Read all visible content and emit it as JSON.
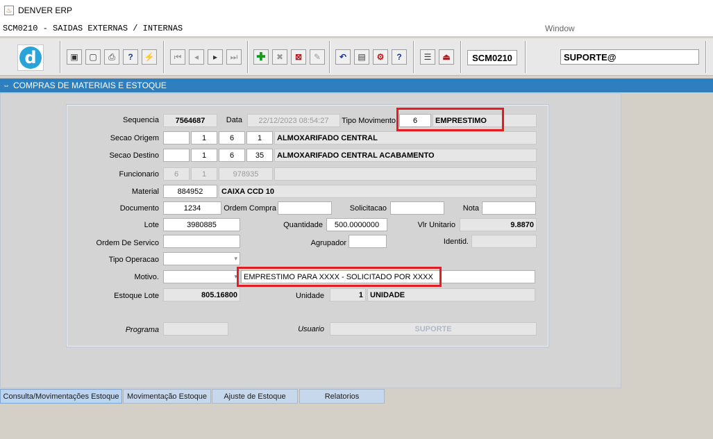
{
  "window": {
    "title": "DENVER ERP",
    "form_name": "SCM0210 - SAIDAS EXTERNAS / INTERNAS",
    "window_menu": "Window"
  },
  "toolbar": {
    "form_code": "SCM0210",
    "user": "SUPORTE@",
    "logo_letter": "d"
  },
  "header": {
    "title": "COMPRAS DE MATERIAIS E ESTOQUE"
  },
  "labels": {
    "sequencia": "Sequencia",
    "data": "Data",
    "tipo_movimento": "Tipo Movimento",
    "secao_origem": "Secao Origem",
    "secao_destino": "Secao Destino",
    "funcionario": "Funcionario",
    "material": "Material",
    "documento": "Documento",
    "ordem_compra": "Ordem Compra",
    "solicitacao": "Solicitacao",
    "nota": "Nota",
    "lote": "Lote",
    "quantidade": "Quantidade",
    "vlr_unitario": "Vlr Unitario",
    "ordem_servico": "Ordem De Servico",
    "agrupador": "Agrupador",
    "identid": "Identid.",
    "tipo_operacao": "Tipo Operacao",
    "motivo": "Motivo.",
    "estoque_lote": "Estoque Lote",
    "unidade": "Unidade",
    "programa": "Programa",
    "usuario": "Usuario"
  },
  "fields": {
    "sequencia": "7564687",
    "data": "22/12/2023 08:54:27",
    "tipo_movimento_code": "6",
    "tipo_movimento_desc": "EMPRESTIMO",
    "secao_origem": [
      "1",
      "6",
      "1"
    ],
    "secao_origem_desc": "ALMOXARIFADO CENTRAL",
    "secao_destino": [
      "1",
      "6",
      "35"
    ],
    "secao_destino_desc": "ALMOXARIFADO CENTRAL ACABAMENTO",
    "funcionario": [
      "6",
      "1",
      "978935"
    ],
    "material_code": "884952",
    "material_desc": "CAIXA CCD 10",
    "documento": "1234",
    "lote": "3980885",
    "quantidade": "500.0000000",
    "vlr_unitario": "9.8870",
    "motivo_text": "EMPRESTIMO PARA XXXX - SOLICITADO POR XXXX",
    "estoque_lote": "805.16800",
    "unidade_code": "1",
    "unidade_desc": "UNIDADE",
    "usuario": "SUPORTE"
  },
  "tabs": [
    {
      "label": "Consulta/Movimentações Estoque"
    },
    {
      "label": "Movimentação Estoque"
    },
    {
      "label": "Ajuste de Estoque"
    },
    {
      "label": "Relatorios"
    }
  ],
  "colors": {
    "accent_blue": "#2f7fbf",
    "highlight_red": "#e01c24"
  }
}
